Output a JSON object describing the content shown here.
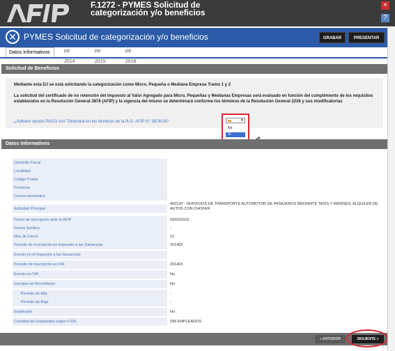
{
  "window": {
    "title": "F.1272 - PYMES Solicitud de categorización y/o beneficios",
    "close_glyph": "×",
    "help_glyph": "?"
  },
  "app_bar": {
    "title": "PYMES Solicitud de categorización y/o beneficios",
    "grabar": "GRABAR",
    "presentar": "PRESENTAR"
  },
  "tabs": [
    {
      "label": "Datos Informativos",
      "active": true
    },
    {
      "label": "PF 2014",
      "active": false
    },
    {
      "label": "PF 2015",
      "active": false
    },
    {
      "label": "PF 2016",
      "active": false
    }
  ],
  "solicitud": {
    "header": "Solicitud de Beneficios",
    "para1": "Mediante esta DJ se está solicitando la categorización como Micro, Pequeña o Mediana Empresa Tramo 1 y 2",
    "para2": "La solicitud del certificado de no retención del Impuesto al Valor Agregado para Micro, Pequeñas y Medianas Empresas será evaluado en función del cumplimiento de los requisitos establecidos en la Resolución General 3878 (AFIP) y la vigencia del mismo se determinará conforme los términos de la Resolución General 2226 y sus modificatorias",
    "question": "¿Adhiere opción PAGO con Trimestral en los términos de la R.G. AFIP N° 3874/16?",
    "select_options": [
      "No",
      "Si"
    ],
    "selected_option": "Si"
  },
  "datos": {
    "header": "Datos Informativos",
    "rows": [
      {
        "label": "Domicilio Fiscal",
        "value": ""
      },
      {
        "label": "Localidad",
        "value": ""
      },
      {
        "label": "Código Postal",
        "value": ""
      },
      {
        "label": "Provincia",
        "value": ""
      },
      {
        "label": "Correo electrónico",
        "value": ""
      },
      {
        "label": "Actividad Principal",
        "value": "492120 - SERVICIOS DE TRANSPORTE AUTOMOTOR DE PASAJEROS MEDIANTE TAXIS Y REMISES; ALQUILER DE AUTOS CON CHOFER"
      },
      {
        "label": "Fecha de Inscripción ante la AFIP",
        "value": "03/02/2015"
      },
      {
        "label": "Forma Jurídica",
        "value": "-"
      },
      {
        "label": "Mes de Cierre",
        "value": "12"
      },
      {
        "label": "Período de Inscripción en Impuesto a las Ganancias",
        "value": "201403"
      },
      {
        "label": "Exento en el Impuesto a las Ganancias",
        "value": ""
      },
      {
        "label": "Período de Inscripción en IVA",
        "value": "201403"
      },
      {
        "label": "Exento en IVA",
        "value": "No"
      },
      {
        "label": "Inscripto en Monotributo",
        "value": "No"
      },
      {
        "label": "Período de Alta",
        "value": "-"
      },
      {
        "label": "Período de Baja",
        "value": "-"
      },
      {
        "label": "Empleador",
        "value": "No"
      },
      {
        "label": "Cantidad de Empleados según F.931",
        "value": "SIN EMPLEADOS"
      }
    ]
  },
  "footer": {
    "anterior": "« ANTERIOR",
    "siguiente": "SIGUIENTE »"
  },
  "colors": {
    "app_bar": "#2b5ba8",
    "section_header": "#6f6f6f",
    "highlight": "#d9272e"
  }
}
